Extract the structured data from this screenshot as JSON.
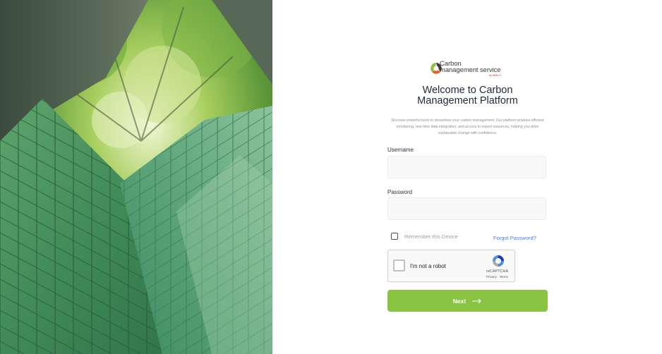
{
  "brand": {
    "logo_line1": "Carbon",
    "logo_line2": "management service",
    "logo_sub": "by AMELIT",
    "colors": {
      "green": "#88c442",
      "orange": "#e85d2a",
      "dark": "#3a3a3a"
    }
  },
  "hero": {
    "image": "glass-buildings-forest-photo"
  },
  "login": {
    "title_line1": "Welcome to Carbon",
    "title_line2": "Management Platform",
    "description": "Discover powerful tools to streamline your carbon management. Our platform enables efficient monitoring, real-time data integration, and access to expert resources, helping you drive sustainable change with confidence.",
    "username_label": "Username",
    "username_value": "",
    "password_label": "Password",
    "password_value": "",
    "remember_label": "Remember this Device",
    "remember_checked": false,
    "forgot_label": "Forgot Password?",
    "next_label": "Next",
    "link_color": "#4f7fe0"
  },
  "recaptcha": {
    "label": "I'm not a robot",
    "brand": "reCAPTCHA",
    "links": "Privacy - Terms"
  }
}
